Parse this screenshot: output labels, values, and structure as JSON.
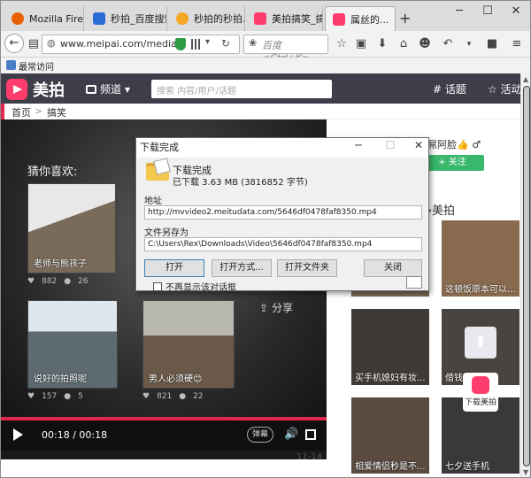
{
  "tabs": [
    {
      "label": "Mozilla Fire...",
      "color": "#e66000"
    },
    {
      "label": "秒拍_百度搜索",
      "color": "#2b6bd6"
    },
    {
      "label": "秒拍的秒拍...",
      "color": "#f5a623"
    },
    {
      "label": "美拍搞笑_搞...",
      "color": "#ff3d6c"
    },
    {
      "label": "属丝的...",
      "color": "#ff3d6c"
    }
  ],
  "navbar": {
    "url": "www.meipai.com/media/",
    "search_placeholder": "百度 <Ctrl+K>"
  },
  "bookmarks": {
    "label": "最常访问"
  },
  "site": {
    "logo": "美拍",
    "channel": "频道",
    "search_placeholder": "搜索 内容/用户/话题",
    "topics": "# 话题",
    "activity": "☆ 活动"
  },
  "breadcrumb": {
    "home": "首页",
    "sep": ">",
    "current": "搞笑"
  },
  "player": {
    "guess_title": "猜你喜欢:",
    "share": "分享",
    "time": "00:18 / 00:18",
    "barrage": "弹幕",
    "page": "11-14",
    "videos": [
      {
        "caption": "老师与熊孩子",
        "likes": "882",
        "comments": "26"
      },
      {
        "caption": "说好的拍照呢",
        "likes": "157",
        "comments": "5"
      },
      {
        "caption": "男人必须硬😊",
        "likes": "821",
        "comments": "22"
      }
    ]
  },
  "right": {
    "user": "屌阿脸👍 ♂",
    "follow": "+ 关注",
    "more_title": "多美拍",
    "thumbs": [
      {
        "caption": ""
      },
      {
        "caption": "这顿饭原本可以..."
      },
      {
        "caption": "买手机媳妇有妆..."
      },
      {
        "caption": "借钱那"
      },
      {
        "caption": "相爱情侣秒是不..."
      },
      {
        "caption": "七夕送手机"
      }
    ],
    "download_app": "下载美拍"
  },
  "dialog": {
    "title": "下载完成",
    "heading": "下载完成",
    "size_line": "已下载 3.63 MB (3816852 字节)",
    "address_label": "地址",
    "address": "http://mvvideo2.meitudata.com/5646df0478faf8350.mp4",
    "saveas_label": "文件另存为",
    "saveas": "C:\\Users\\Rex\\Downloads\\Video\\5646df0478faf8350.mp4",
    "buttons": [
      "打开",
      "打开方式...",
      "打开文件夹",
      "关闭"
    ],
    "checkbox": "不再显示该对话框"
  },
  "colors": {
    "brand": "#ff3d6c",
    "header": "#3d3e4a",
    "follow": "#39b86b",
    "progress": "#e0284f"
  }
}
